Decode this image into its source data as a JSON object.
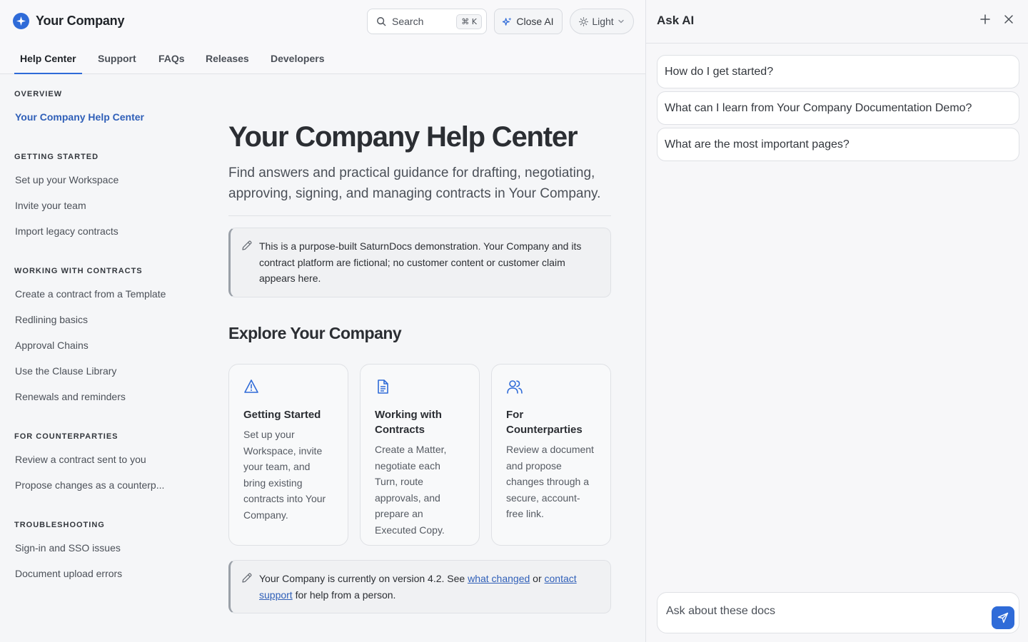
{
  "header": {
    "brand": "Your Company",
    "search_label": "Search",
    "search_shortcut": "⌘ K",
    "close_ai": "Close AI",
    "theme": "Light"
  },
  "tabs": [
    "Help Center",
    "Support",
    "FAQs",
    "Releases",
    "Developers"
  ],
  "sidebar": {
    "overview": {
      "heading": "OVERVIEW",
      "items": [
        "Your Company Help Center"
      ]
    },
    "getting_started": {
      "heading": "GETTING STARTED",
      "items": [
        "Set up your Workspace",
        "Invite your team",
        "Import legacy contracts"
      ]
    },
    "working": {
      "heading": "WORKING WITH CONTRACTS",
      "items": [
        "Create a contract from a Template",
        "Redlining basics",
        "Approval Chains",
        "Use the Clause Library",
        "Renewals and reminders"
      ]
    },
    "counterparties": {
      "heading": "FOR COUNTERPARTIES",
      "items": [
        "Review a contract sent to you",
        "Propose changes as a counterp..."
      ]
    },
    "troubleshooting": {
      "heading": "TROUBLESHOOTING",
      "items": [
        "Sign-in and SSO issues",
        "Document upload errors"
      ]
    }
  },
  "content": {
    "title": "Your Company Help Center",
    "lead": "Find answers and practical guidance for drafting, negotiating, approving, signing, and managing contracts in Your Company.",
    "note1": "This is a purpose-built SaturnDocs demonstration. Your Company and its contract platform are fictional; no customer content or customer claim appears here.",
    "explore_heading": "Explore Your Company",
    "cards": [
      {
        "title": "Getting Started",
        "desc": "Set up your Workspace, invite your team, and bring existing contracts into Your Company."
      },
      {
        "title": "Working with Contracts",
        "desc": "Create a Matter, negotiate each Turn, route approvals, and prepare an Executed Copy."
      },
      {
        "title": "For Counterparties",
        "desc": "Review a document and propose changes through a secure, account-free link."
      }
    ],
    "note2": {
      "before": "Your Company is currently on version 4.2. See ",
      "link1": "what changed",
      "middle": " or ",
      "link2": "contact support",
      "after": " for help from a person."
    }
  },
  "ai": {
    "title": "Ask AI",
    "suggestions": [
      "How do I get started?",
      "What can I learn from Your Company Documentation Demo?",
      "What are the most important pages?"
    ],
    "input_placeholder": "Ask about these docs"
  },
  "colors": {
    "accent": "#2f6bd8",
    "link": "#2f5fb8"
  }
}
